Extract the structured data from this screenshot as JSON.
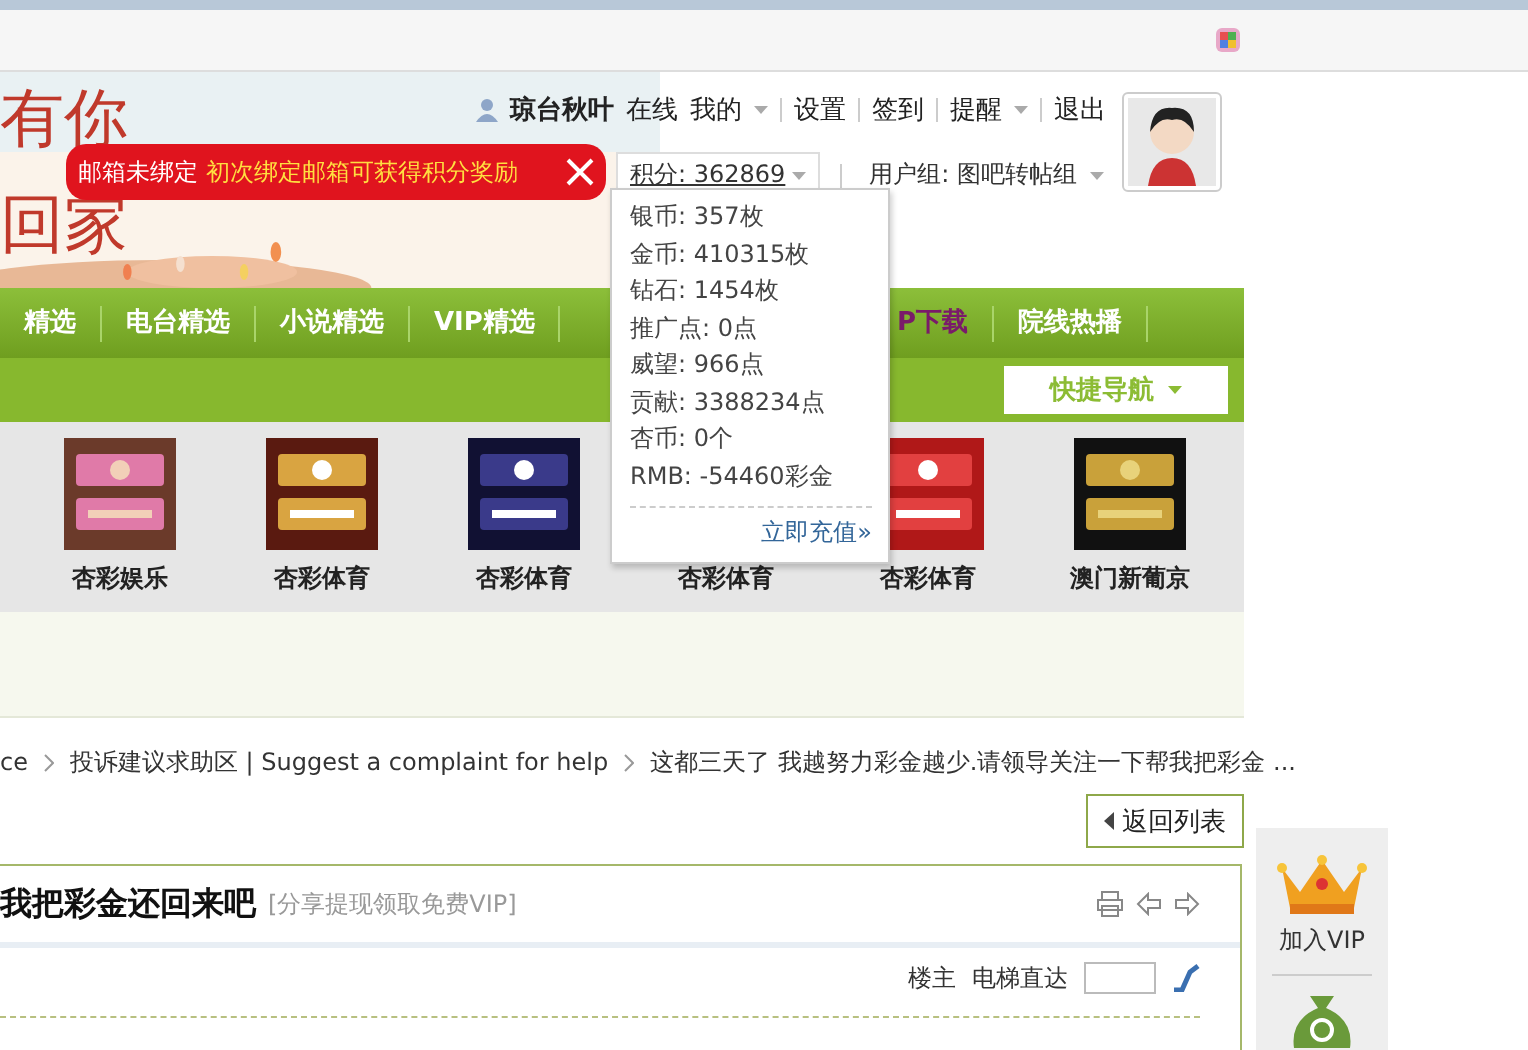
{
  "banner": {
    "logo_lines": [
      "有你",
      "回家"
    ]
  },
  "user_bar": {
    "username": "琼台秋叶",
    "links": [
      {
        "label": "在线",
        "dropdown": false
      },
      {
        "label": "我的",
        "dropdown": true
      },
      {
        "label": "设置",
        "dropdown": false
      },
      {
        "label": "签到",
        "dropdown": false
      },
      {
        "label": "提醒",
        "dropdown": true
      },
      {
        "label": "退出",
        "dropdown": false
      }
    ],
    "points": "积分: 362869",
    "user_group": "用户组: 图吧转帖组"
  },
  "email_notice": {
    "label": "邮箱未绑定",
    "message": "初次绑定邮箱可获得积分奖励"
  },
  "points_menu": {
    "items": [
      "银币: 357枚",
      "金币: 410315枚",
      "钻石: 1454枚",
      "推广点: 0点",
      "威望: 966点",
      "贡献: 3388234点",
      "杏币: 0个",
      "RMB: -54460彩金"
    ],
    "recharge": "立即充值»"
  },
  "nav": {
    "items": [
      {
        "label": "精选"
      },
      {
        "label": "电台精选"
      },
      {
        "label": "小说精选"
      },
      {
        "label": "VIP精选"
      },
      {
        "label": "P下载"
      },
      {
        "label": "院线热播"
      }
    ],
    "quick_nav": "快捷导航"
  },
  "ads": [
    {
      "label": "杏彩娱乐",
      "picture_shown": true
    },
    {
      "label": "杏彩体育",
      "picture_shown": true
    },
    {
      "label": "杏彩体育",
      "picture_shown": true
    },
    {
      "label": "杏彩体育",
      "picture_shown": false
    },
    {
      "label": "杏彩体育",
      "picture_shown": true
    },
    {
      "label": "澳门新葡京",
      "picture_shown": true
    }
  ],
  "breadcrumb": [
    "ce",
    "投诉建议求助区 | Suggest a complaint for help",
    "这都三天了 我越努力彩金越少.请领导关注一下帮我把彩金 ..."
  ],
  "back_button": "返回列表",
  "thread": {
    "title": "我把彩金还回来吧",
    "tag": "[分享提现领取免费VIP]",
    "author_label": "楼主",
    "jump_label": "电梯直达"
  },
  "sidebar": {
    "vip_label": "加入VIP"
  }
}
